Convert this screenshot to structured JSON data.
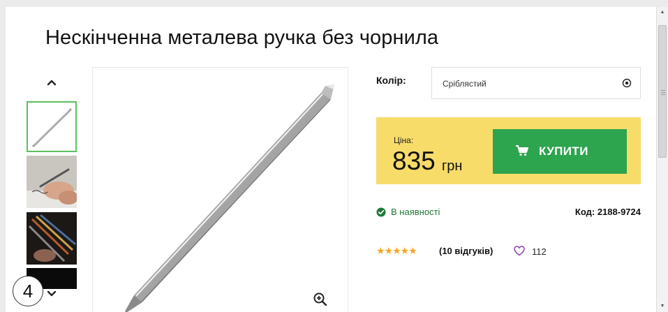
{
  "product": {
    "title": "Нескінченна металева ручка без чорнила"
  },
  "gallery": {
    "thumbnails": [
      "pen-silver",
      "hand-writing",
      "pens-colors",
      "dark-image"
    ],
    "selected_index": 0
  },
  "options": {
    "color_label": "Колір:",
    "color_value": "Сріблястий"
  },
  "price": {
    "label": "Ціна:",
    "amount": "835",
    "currency": "грн",
    "buy_label": "КУПИТИ"
  },
  "availability": {
    "status": "В наявності",
    "code": "Код: 2188-9724"
  },
  "rating": {
    "stars": "★★★★★",
    "reviews": "(10 відгуків)",
    "likes": "112"
  },
  "annotation": {
    "step": "4"
  },
  "colors": {
    "accent_green": "#2da44e",
    "price_bg": "#f7dc6a",
    "stock_green": "#1f7a36",
    "star": "#f5a623",
    "heart": "#8e44ad"
  },
  "icons": [
    "chevron-up-icon",
    "chevron-down-icon",
    "zoom-in-icon",
    "select-arrow-icon",
    "cart-icon",
    "check-circle-icon",
    "heart-icon"
  ]
}
